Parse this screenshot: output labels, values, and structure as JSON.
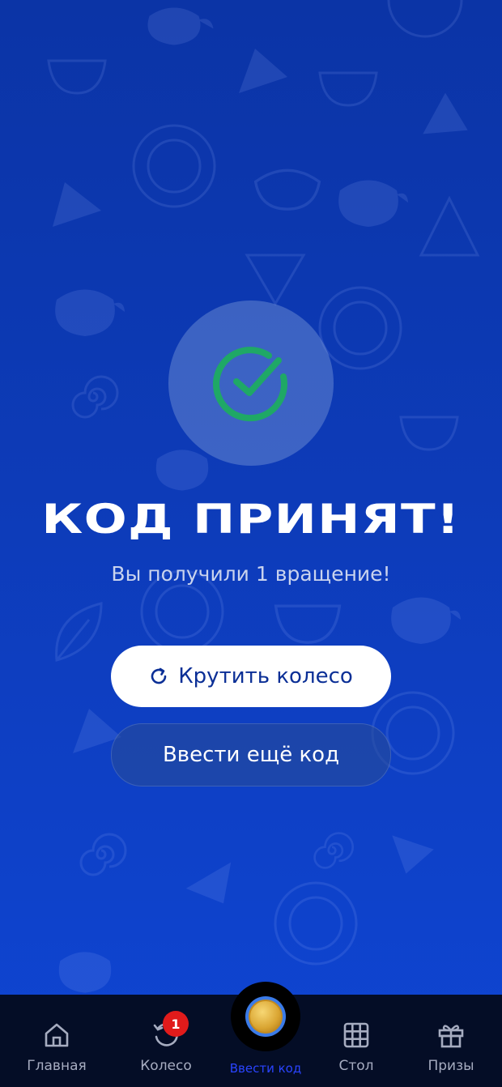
{
  "status": {
    "icon": "check-circle-icon",
    "title": "КОД ПРИНЯТ!",
    "subtitle": "Вы получили 1 вращение!"
  },
  "actions": {
    "spin_label": "Крутить колесо",
    "spin_icon": "refresh-icon",
    "enter_more_label": "Ввести ещё код"
  },
  "nav": {
    "items": [
      {
        "label": "Главная",
        "icon": "home-icon"
      },
      {
        "label": "Колесо",
        "icon": "wheel-refresh-icon",
        "badge": "1"
      },
      {
        "label": "Ввести код",
        "icon": "coin-icon",
        "active": true
      },
      {
        "label": "Стол",
        "icon": "grid-icon"
      },
      {
        "label": "Призы",
        "icon": "gift-icon"
      }
    ]
  },
  "colors": {
    "background": "#0d3bb8",
    "check": "#1fa866",
    "nav_active": "#2a44ff",
    "badge": "#e11b1b",
    "nav_bg": "#040d26"
  }
}
